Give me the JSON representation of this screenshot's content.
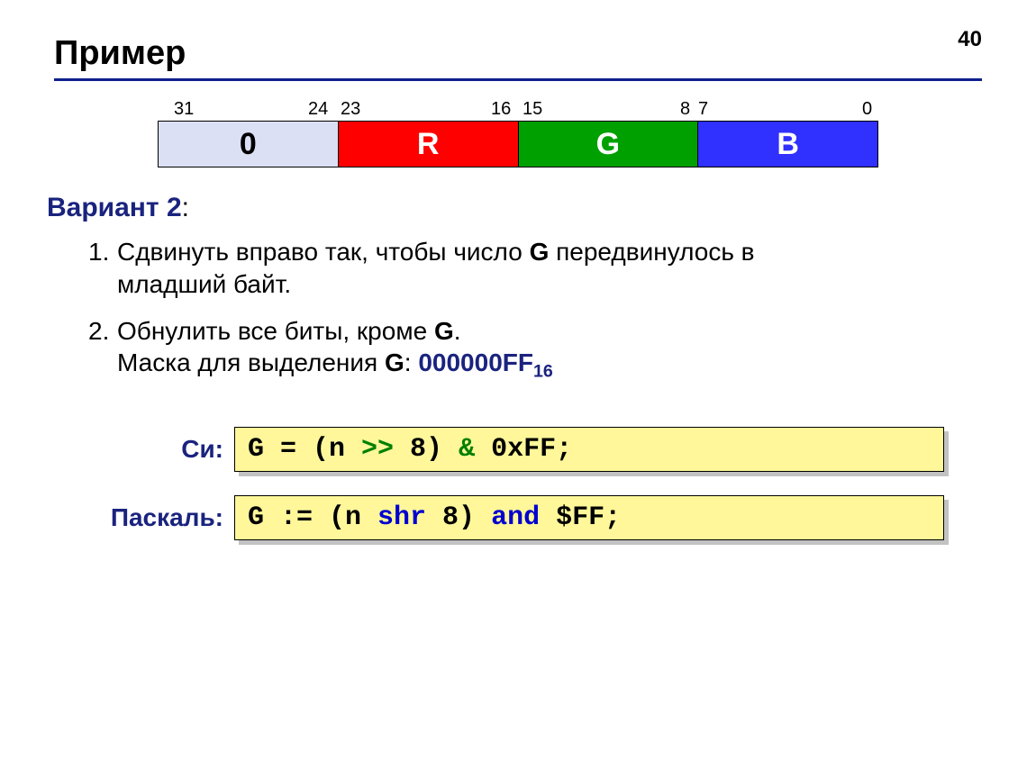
{
  "page_number": "40",
  "title": "Пример",
  "diagram": {
    "bit_labels": {
      "b31": "31",
      "b24": "24",
      "b23": "23",
      "b16": "16",
      "b15": "15",
      "b8": "8",
      "b7": "7",
      "b0": "0"
    },
    "bytes": {
      "zero": "0",
      "r": "R",
      "g": "G",
      "b": "B"
    }
  },
  "variant": {
    "label": "Вариант 2",
    "colon": ":"
  },
  "steps": {
    "s1": {
      "num": "1.",
      "text_a": "Сдвинуть вправо так, чтобы число ",
      "bold": "G",
      "text_b": " передвинулось в",
      "line2": "младший байт."
    },
    "s2": {
      "num": "2.",
      "text_a": "Обнулить все биты, кроме ",
      "bold": "G",
      "dot": ".",
      "line2_a": "Маска для выделения ",
      "line2_bold": "G",
      "line2_b": ": ",
      "mask": "000000FF",
      "base": "16"
    }
  },
  "code": {
    "c_label": "Си:",
    "pascal_label": "Паскаль:",
    "c": {
      "p1": "G = (n ",
      "op": ">>",
      "p2": " 8) ",
      "amp": "&",
      "p3": " 0xFF;"
    },
    "pascal": {
      "p1": "G := (n ",
      "shr": "shr",
      "p2": " 8) ",
      "and": "and",
      "p3": " $FF;"
    }
  }
}
